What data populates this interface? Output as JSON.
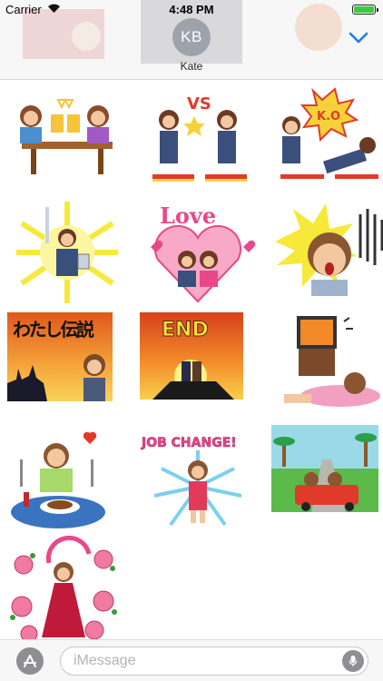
{
  "status_bar": {
    "carrier": "Carrier",
    "time": "4:48 PM",
    "battery_level": 1.0
  },
  "header": {
    "avatar_initials": "KB",
    "contact_name": "Kate",
    "collapse_icon": "chevron-down-icon"
  },
  "stickers": [
    {
      "name": "sticker-toast-beers",
      "icon": "toast-beers"
    },
    {
      "name": "sticker-vs-battle",
      "icon": "vs-battle",
      "text": "VS"
    },
    {
      "name": "sticker-ko",
      "icon": "ko-knockout",
      "text": "K.O"
    },
    {
      "name": "sticker-hero-sword",
      "icon": "hero-sword"
    },
    {
      "name": "sticker-love-heart",
      "icon": "love-heart",
      "text": "Love"
    },
    {
      "name": "sticker-shock",
      "icon": "shock"
    },
    {
      "name": "sticker-legend",
      "icon": "legend-sunset",
      "text": "わたし伝説"
    },
    {
      "name": "sticker-end",
      "icon": "end-sunset",
      "text": "END"
    },
    {
      "name": "sticker-tv-lazy",
      "icon": "tv-lazy"
    },
    {
      "name": "sticker-dinner",
      "icon": "dinner"
    },
    {
      "name": "sticker-job-change",
      "icon": "job-change",
      "text": "JOB CHANGE!"
    },
    {
      "name": "sticker-car-drive",
      "icon": "car-drive"
    },
    {
      "name": "sticker-roses-dress",
      "icon": "roses-dress"
    }
  ],
  "compose": {
    "placeholder": "iMessage",
    "value": "",
    "appstore_icon": "appstore-icon",
    "mic_icon": "microphone-icon"
  },
  "colors": {
    "accent": "#1a7cf2",
    "avatar_bg": "#9ea3ab",
    "battery": "#3acb3a"
  }
}
